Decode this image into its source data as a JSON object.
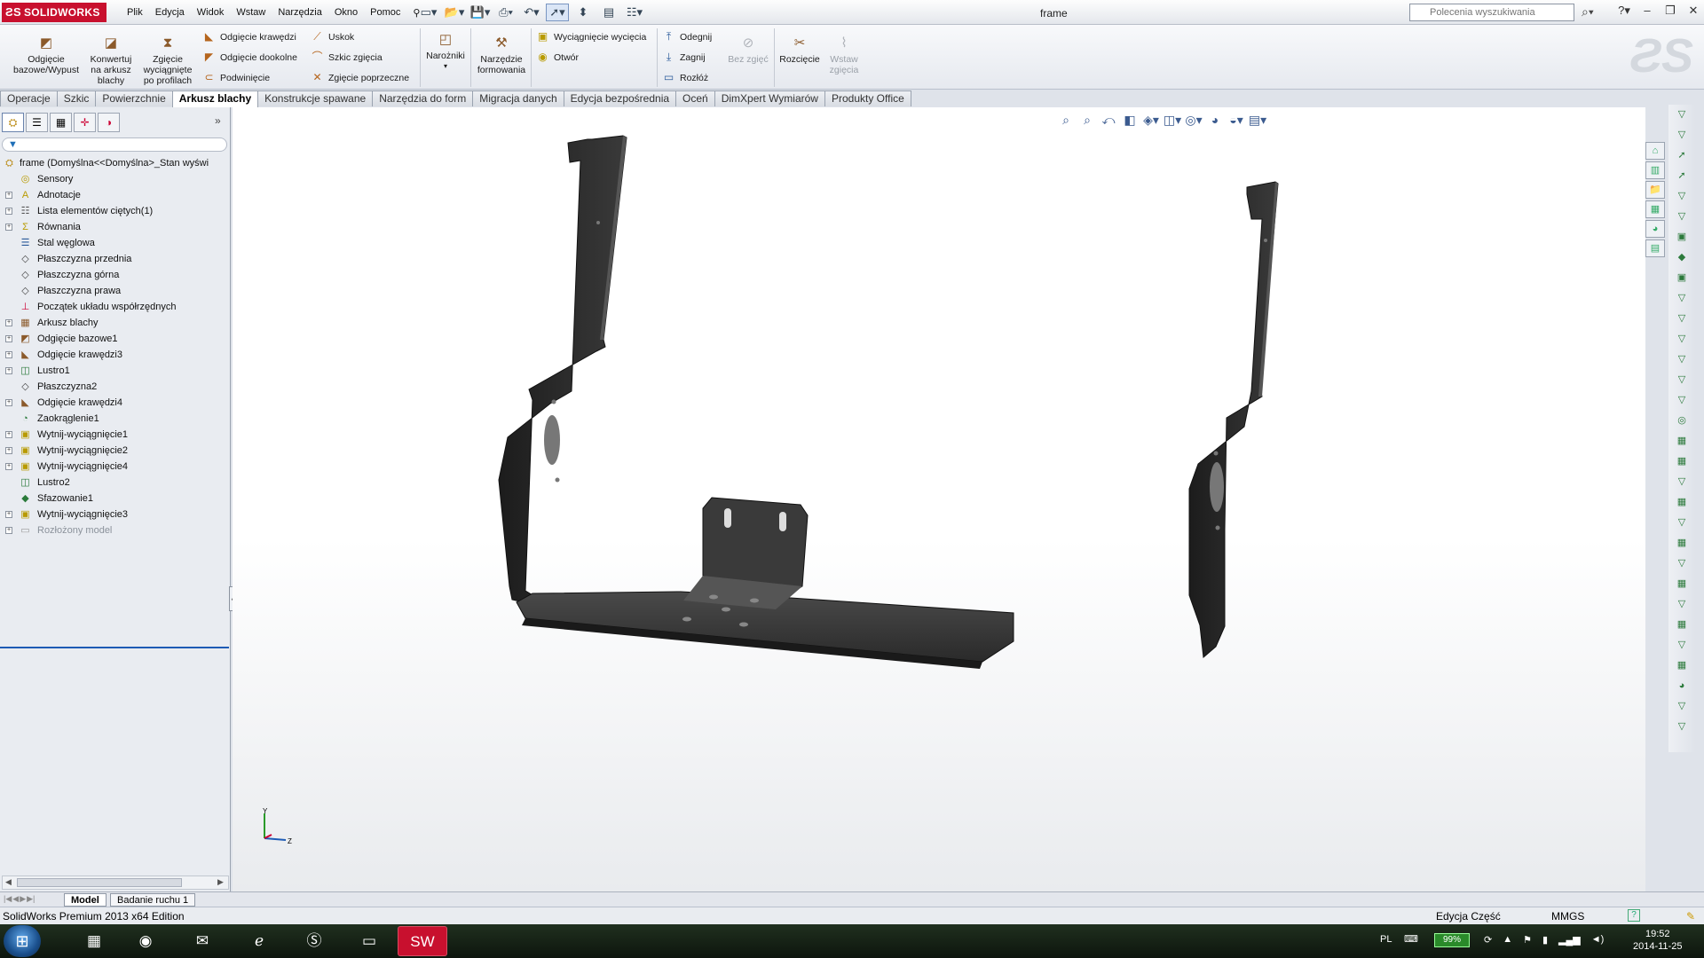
{
  "app": {
    "brand": "SOLIDWORKS",
    "document_title": "frame",
    "menu": [
      "Plik",
      "Edycja",
      "Widok",
      "Wstaw",
      "Narzędzia",
      "Okno",
      "Pomoc"
    ],
    "search_placeholder": "Polecenia wyszukiwania"
  },
  "command_manager": {
    "big_buttons": [
      {
        "label": "Odgięcie bazowe/Wypust",
        "icon": "base-flange-icon"
      },
      {
        "label": "Konwertuj na arkusz blachy",
        "icon": "convert-sheet-metal-icon"
      },
      {
        "label": "Zgięcie wyciągnięte po profilach",
        "icon": "lofted-bend-icon"
      }
    ],
    "col1": [
      "Odgięcie krawędzi",
      "Odgięcie dookolne",
      "Podwinięcie"
    ],
    "col2": [
      "Uskok",
      "Szkic zgięcia",
      "Zgięcie poprzeczne"
    ],
    "corners": "Narożniki",
    "forming_tool": "Narzędzie formowania",
    "col3": [
      "Wyciągnięcie wycięcia",
      "Otwór"
    ],
    "col4": [
      "Odegnij",
      "Zagnij",
      "Rozłóż"
    ],
    "no_bends": "Bez zgięć",
    "rip": "Rozcięcie",
    "insert_bends": "Wstaw zgięcia"
  },
  "tabs": [
    "Operacje",
    "Szkic",
    "Powierzchnie",
    "Arkusz blachy",
    "Konstrukcje spawane",
    "Narzędzia do form",
    "Migracja danych",
    "Edycja bezpośrednia",
    "Oceń",
    "DimXpert Wymiarów",
    "Produkty Office"
  ],
  "active_tab": "Arkusz blachy",
  "feature_tree": {
    "root": "frame  (Domyślna<<Domyślna>_Stan wyświ",
    "items": [
      {
        "label": "Sensory",
        "expand": false,
        "icon": "sensor-icon"
      },
      {
        "label": "Adnotacje",
        "expand": true,
        "icon": "annotation-icon"
      },
      {
        "label": "Lista elementów ciętych(1)",
        "expand": true,
        "icon": "cut-list-icon"
      },
      {
        "label": "Równania",
        "expand": true,
        "icon": "equations-icon"
      },
      {
        "label": "Stal węglowa",
        "expand": false,
        "icon": "material-icon"
      },
      {
        "label": "Płaszczyzna przednia",
        "expand": false,
        "icon": "plane-icon"
      },
      {
        "label": "Płaszczyzna górna",
        "expand": false,
        "icon": "plane-icon"
      },
      {
        "label": "Płaszczyzna prawa",
        "expand": false,
        "icon": "plane-icon"
      },
      {
        "label": "Początek układu współrzędnych",
        "expand": false,
        "icon": "origin-icon"
      },
      {
        "label": "Arkusz blachy",
        "expand": true,
        "icon": "sheet-metal-icon"
      },
      {
        "label": "Odgięcie bazowe1",
        "expand": true,
        "icon": "base-flange-icon"
      },
      {
        "label": "Odgięcie krawędzi3",
        "expand": true,
        "icon": "edge-flange-icon"
      },
      {
        "label": "Lustro1",
        "expand": true,
        "icon": "mirror-icon"
      },
      {
        "label": "Płaszczyzna2",
        "expand": false,
        "icon": "plane-icon"
      },
      {
        "label": "Odgięcie krawędzi4",
        "expand": true,
        "icon": "edge-flange-icon"
      },
      {
        "label": "Zaokrąglenie1",
        "expand": false,
        "icon": "fillet-icon"
      },
      {
        "label": "Wytnij-wyciągnięcie1",
        "expand": true,
        "icon": "cut-extrude-icon"
      },
      {
        "label": "Wytnij-wyciągnięcie2",
        "expand": true,
        "icon": "cut-extrude-icon"
      },
      {
        "label": "Wytnij-wyciągnięcie4",
        "expand": true,
        "icon": "cut-extrude-icon"
      },
      {
        "label": "Lustro2",
        "expand": false,
        "icon": "mirror-icon"
      },
      {
        "label": "Sfazowanie1",
        "expand": false,
        "icon": "chamfer-icon"
      },
      {
        "label": "Wytnij-wyciągnięcie3",
        "expand": true,
        "icon": "cut-extrude-icon"
      },
      {
        "label": "Rozłożony model",
        "expand": true,
        "icon": "flat-pattern-icon",
        "dim": true
      }
    ]
  },
  "bottom_tabs": [
    "Model",
    "Badanie ruchu 1"
  ],
  "status": {
    "product": "SolidWorks Premium 2013 x64 Edition",
    "mode": "Edycja Część",
    "units": "MMGS"
  },
  "taskbar": {
    "language": "PL",
    "battery": "99%",
    "time": "19:52",
    "date": "2014-11-25"
  },
  "colors": {
    "brand_red": "#c8102e",
    "model_dark": "#2b2b2b",
    "accent_blue": "#1d5bb5"
  },
  "triad": {
    "y": "Y",
    "z": "Z"
  }
}
